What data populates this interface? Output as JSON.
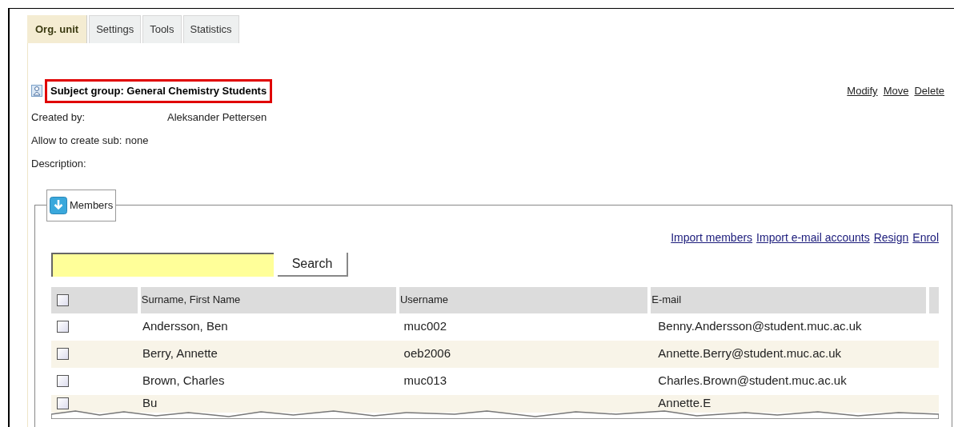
{
  "tabs": [
    {
      "label": "Org. unit",
      "selected": true
    },
    {
      "label": "Settings",
      "selected": false
    },
    {
      "label": "Tools",
      "selected": false
    },
    {
      "label": "Statistics",
      "selected": false
    }
  ],
  "heading": {
    "title": "Subject group: General Chemistry Students",
    "highlighted": true
  },
  "actions": [
    "Modify",
    "Move",
    "Delete"
  ],
  "details": [
    {
      "label": "Created by:",
      "value": "Aleksander Pettersen"
    },
    {
      "label": "Allow to create sub:",
      "value": "none"
    },
    {
      "label": "Description:"
    }
  ],
  "members": {
    "legend": "Members",
    "links": [
      "Import members",
      "Import e-mail accounts",
      "Resign",
      "Enrol"
    ],
    "search": {
      "button": "Search"
    },
    "table": {
      "select_all": {
        "checked": false
      },
      "columns": [
        "Surname, First Name",
        "Username",
        "E-mail"
      ],
      "rows": [
        {
          "checked": false,
          "cells": [
            "Andersson, Ben",
            "muc002",
            "Benny.Andersson@student.muc.ac.uk"
          ]
        },
        {
          "checked": false,
          "cells": [
            "Berry, Annette",
            "oeb2006",
            "Annette.Berry@student.muc.ac.uk"
          ]
        },
        {
          "checked": false,
          "cells": [
            "Brown, Charles",
            "muc013",
            "Charles.Brown@student.muc.ac.uk"
          ]
        },
        {
          "checked": false,
          "cells": [
            "Bu",
            "",
            "Annette.E"
          ]
        }
      ]
    }
  }
}
